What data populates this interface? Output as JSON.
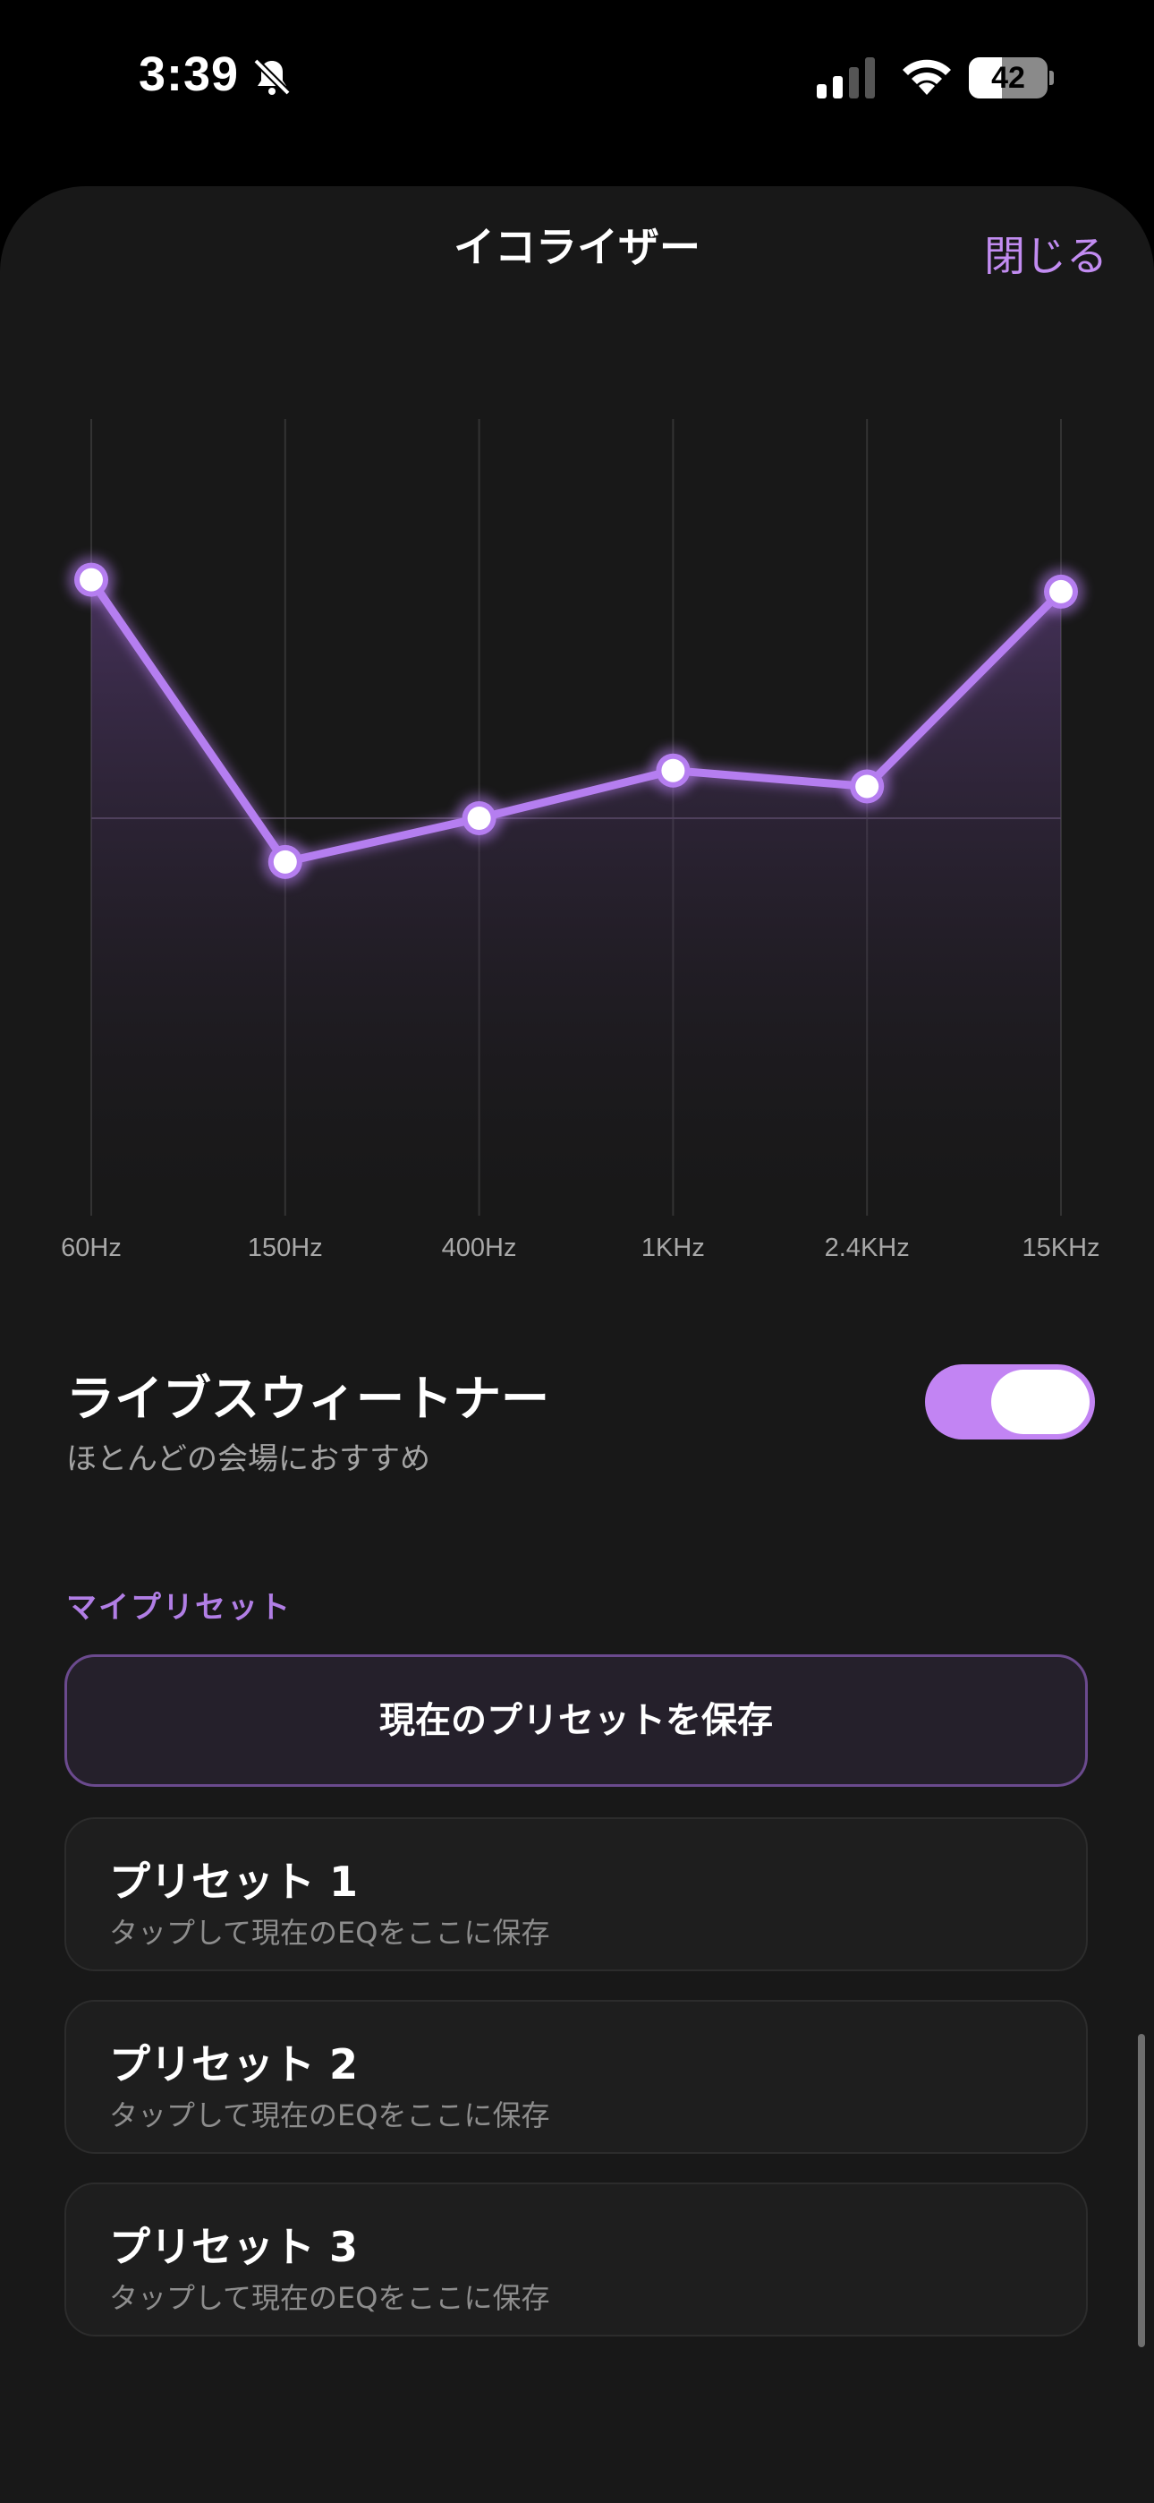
{
  "status_bar": {
    "time": "3:39",
    "battery": "42",
    "battery_level": 0.42,
    "icons": [
      "bell-slash-icon",
      "cellular-signal-icon",
      "wifi-icon",
      "battery-icon"
    ]
  },
  "header": {
    "title": "イコライザー",
    "close_label": "閉じる"
  },
  "colors": {
    "accent": "#c28cf1",
    "toggle_on": "#c284f3",
    "sheet_bg": "#181818"
  },
  "chart_data": {
    "type": "line",
    "categories": [
      "60Hz",
      "150Hz",
      "400Hz",
      "1KHz",
      "2.4KHz",
      "15KHz"
    ],
    "values": [
      0.6,
      -0.11,
      0.0,
      0.12,
      0.08,
      0.57
    ],
    "ylim": [
      -1,
      1
    ],
    "grid": true
  },
  "live_sweetener": {
    "title": "ライブスウィートナー",
    "subtitle": "ほとんどの会場におすすめ",
    "enabled": true
  },
  "presets": {
    "section_title": "マイプリセット",
    "save_label": "現在のプリセットを保存",
    "items": [
      {
        "name": "プリセット 1",
        "desc": "タップして現在のEQをここに保存"
      },
      {
        "name": "プリセット 2",
        "desc": "タップして現在のEQをここに保存"
      },
      {
        "name": "プリセット 3",
        "desc": "タップして現在のEQをここに保存"
      }
    ]
  }
}
